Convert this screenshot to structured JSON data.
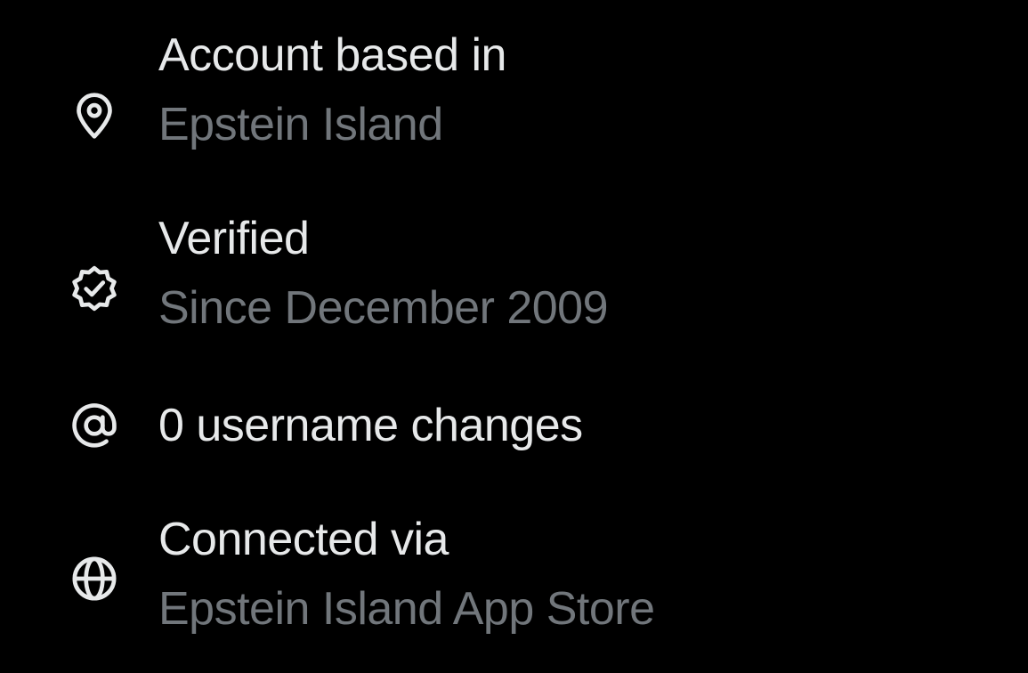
{
  "items": [
    {
      "icon": "location-pin-icon",
      "title": "Account based in",
      "subtitle": "Epstein Island"
    },
    {
      "icon": "verified-badge-icon",
      "title": "Verified",
      "subtitle": "Since December 2009"
    },
    {
      "icon": "at-sign-icon",
      "title": "0 username changes"
    },
    {
      "icon": "globe-icon",
      "title": "Connected via",
      "subtitle": "Epstein Island App Store"
    }
  ],
  "colors": {
    "background": "#000000",
    "primary_text": "#e7e9ea",
    "secondary_text": "#71767b",
    "icon": "#e7e9ea"
  }
}
